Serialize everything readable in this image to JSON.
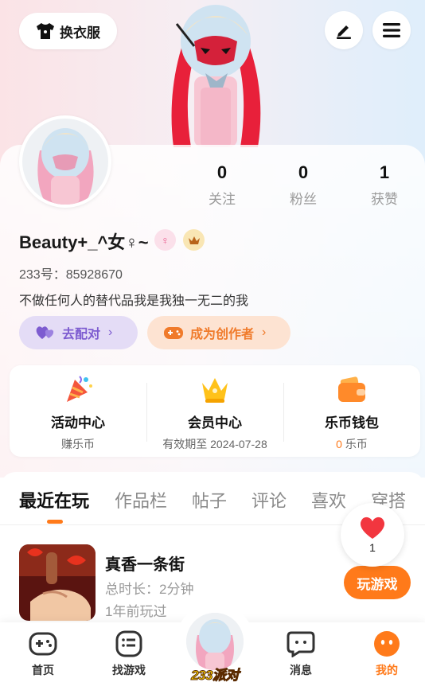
{
  "header": {
    "change_outfit_label": "换衣服",
    "edit_icon": "pen-icon",
    "menu_icon": "hamburger-icon"
  },
  "profile": {
    "stats": [
      {
        "value": "0",
        "label": "关注"
      },
      {
        "value": "0",
        "label": "粉丝"
      },
      {
        "value": "1",
        "label": "获赞"
      }
    ],
    "username": "Beauty+_^女♀~",
    "uid_label": "233号：",
    "uid": "85928670",
    "bio": "不做任何人的替代品我是我独一无二的我",
    "pair_button": "去配对",
    "creator_button": "成为创作者"
  },
  "services": [
    {
      "title": "活动中心",
      "subtitle": "赚乐币"
    },
    {
      "title": "会员中心",
      "subtitle": "有效期至 2024-07-28"
    },
    {
      "title": "乐币钱包",
      "amount": "0",
      "unit": "乐币"
    }
  ],
  "tabs": [
    "最近在玩",
    "作品栏",
    "帖子",
    "评论",
    "喜欢",
    "穿搭"
  ],
  "recent_game": {
    "title": "真香一条街",
    "duration": "总时长：2分钟",
    "last_played": "1年前玩过",
    "play_button": "玩游戏"
  },
  "like_count": "1",
  "bottom_nav": [
    {
      "label": "首页"
    },
    {
      "label": "找游戏"
    },
    {
      "label": "233派对"
    },
    {
      "label": "消息"
    },
    {
      "label": "我的"
    }
  ],
  "colors": {
    "accent": "#ff7a1a",
    "purple": "#7d5cd0",
    "pink_bg": "#fbe3e6"
  }
}
